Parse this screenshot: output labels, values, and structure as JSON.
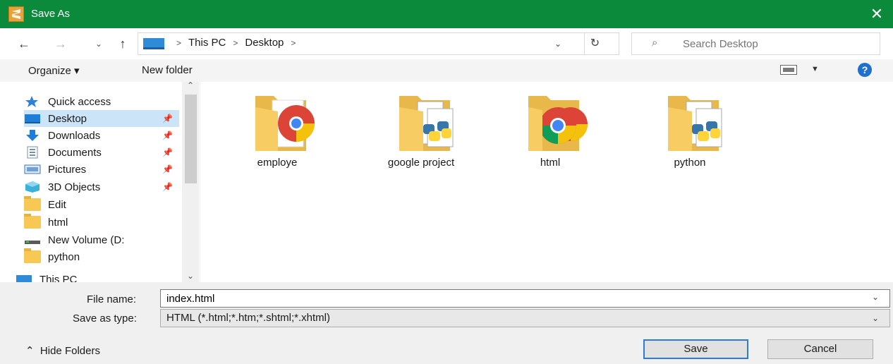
{
  "window": {
    "title": "Save As",
    "close_glyph": "✕"
  },
  "address": {
    "crumbs": [
      "This PC",
      "Desktop"
    ],
    "search_placeholder": "Search Desktop"
  },
  "toolbar": {
    "organize_label": "Organize ▾",
    "new_folder_label": "New folder",
    "help_label": "?"
  },
  "nav": {
    "items": [
      {
        "label": "Quick access",
        "icon": "star-icon",
        "pinned": false
      },
      {
        "label": "Desktop",
        "icon": "desktop-icon",
        "pinned": true,
        "selected": true
      },
      {
        "label": "Downloads",
        "icon": "download-arrow-icon",
        "pinned": true
      },
      {
        "label": "Documents",
        "icon": "documents-icon",
        "pinned": true
      },
      {
        "label": "Pictures",
        "icon": "pictures-icon",
        "pinned": true
      },
      {
        "label": "3D Objects",
        "icon": "3d-objects-icon",
        "pinned": true
      },
      {
        "label": "Edit",
        "icon": "folder-icon",
        "pinned": false
      },
      {
        "label": "html",
        "icon": "folder-icon",
        "pinned": false
      },
      {
        "label": "New Volume (D:",
        "icon": "drive-icon",
        "pinned": false
      },
      {
        "label": "python",
        "icon": "folder-icon",
        "pinned": false
      },
      {
        "label": "This PC",
        "icon": "this-pc-icon",
        "pinned": false
      }
    ]
  },
  "files": [
    {
      "name": "employe",
      "icon": "folder-chrome-icon"
    },
    {
      "name": "google project",
      "icon": "folder-python-icon"
    },
    {
      "name": "html",
      "icon": "folder-chrome-icon"
    },
    {
      "name": "python",
      "icon": "folder-python-icon"
    }
  ],
  "form": {
    "filename_label": "File name:",
    "filename_value": "index.html",
    "savetype_label": "Save as type:",
    "savetype_value": "HTML (*.html;*.htm;*.shtml;*.xhtml)",
    "hide_folders_label": "Hide Folders",
    "save_label": "Save",
    "cancel_label": "Cancel"
  },
  "colors": {
    "titlebar": "#0c8a3c",
    "selection": "#cce4f7",
    "accent": "#2f7ad9"
  }
}
